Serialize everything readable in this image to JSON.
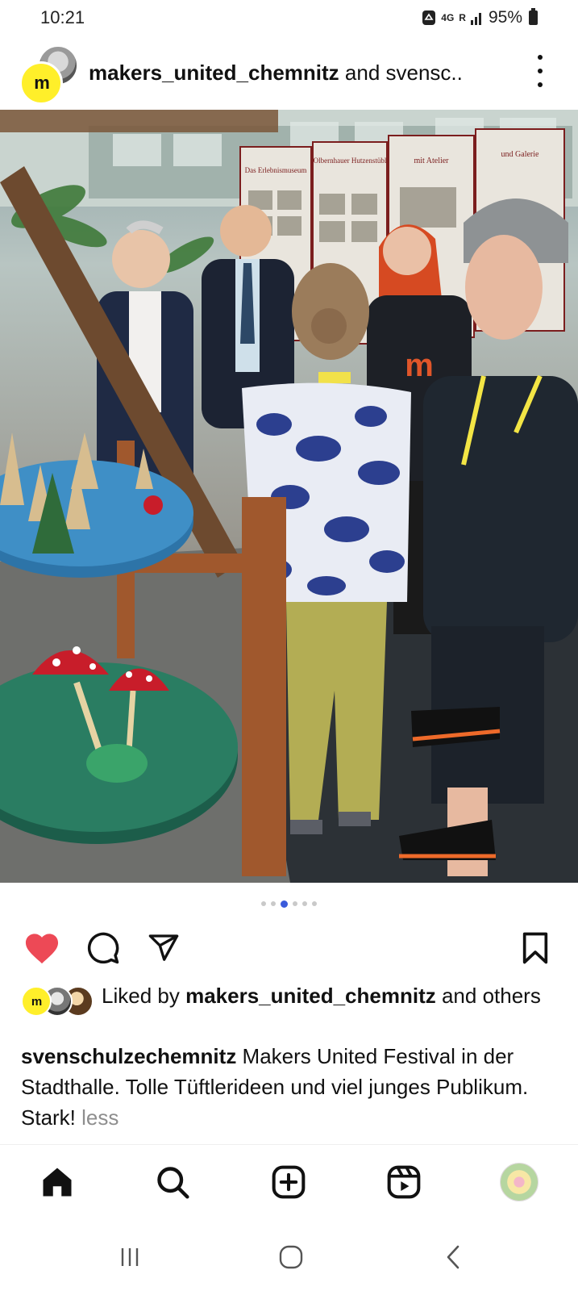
{
  "status": {
    "time": "10:21",
    "network": "4G",
    "roaming": "R",
    "battery": "95%"
  },
  "post": {
    "header_user": "makers_united_chemnitz",
    "header_rest": " and svensc..",
    "avatar_letter": "m"
  },
  "carousel": {
    "count": 6,
    "active": 2
  },
  "photo_signs": [
    "Das Erlebnismuseum",
    "Olbernhauer Hutzenstübl",
    "mit Atelier",
    "und Galerie"
  ],
  "likes": {
    "prefix": "Liked by ",
    "user": "makers_united_chemnitz",
    "suffix": " and others"
  },
  "caption": {
    "user": "svenschulzechemnitz",
    "text": " Makers United Festival in der Stadthalle. Tolle Tüftlerideen und viel junges Publikum. Stark!",
    "more": " less"
  },
  "colors": {
    "like_red": "#ed4956",
    "accent_blue": "#3b5bdb",
    "brand_yellow": "#ffef2a"
  },
  "icons": {
    "like": "heart-icon",
    "comment": "comment-icon",
    "share": "send-icon",
    "save": "bookmark-icon",
    "home": "home-icon",
    "search": "search-icon",
    "create": "add-post-icon",
    "reels": "reels-icon"
  }
}
